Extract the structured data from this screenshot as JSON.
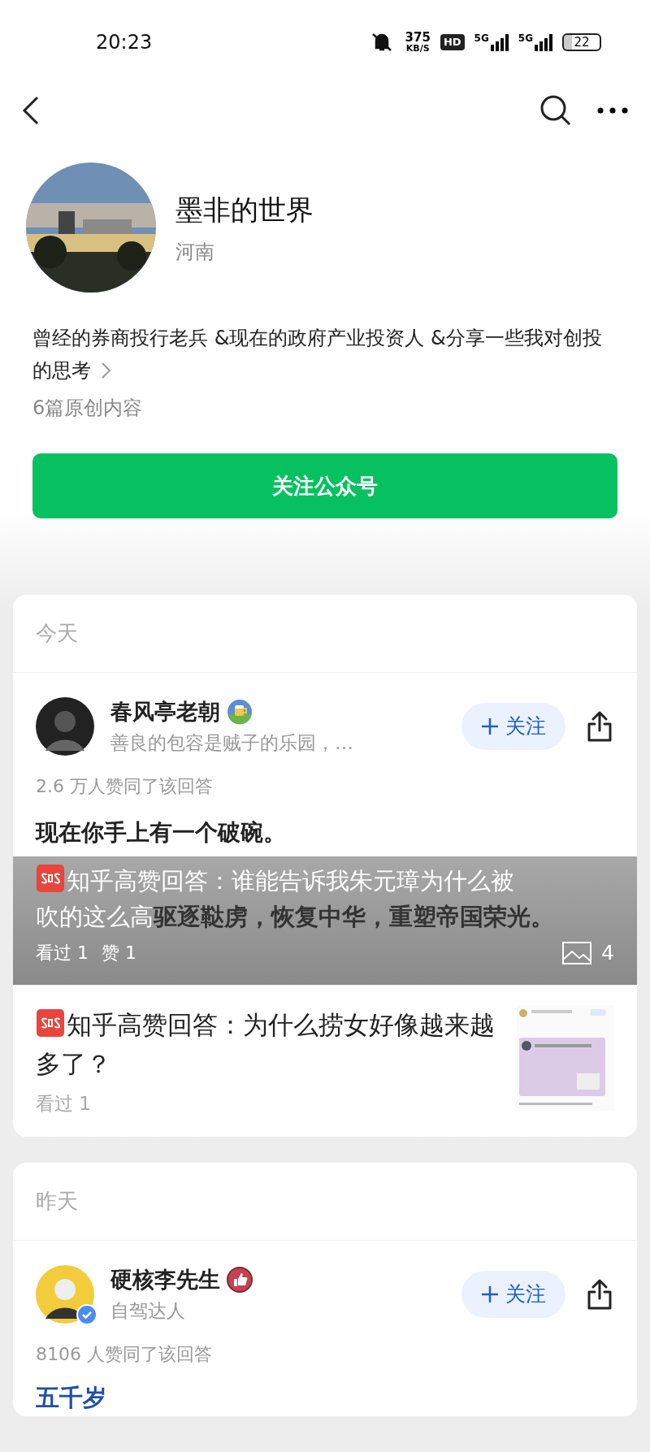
{
  "status_bar": {
    "time": "20:23",
    "speed": "375",
    "speed_unit": "KB/S",
    "hd": "HD",
    "net1": "5G",
    "net2": "5G",
    "battery": "22"
  },
  "profile": {
    "name": "墨非的世界",
    "location": "河南",
    "bio": "曾经的券商投行老兵 &现在的政府产业投资人 &分享一些我对创投的思考",
    "count": "6篇原创内容",
    "follow_button": "关注公众号"
  },
  "sections": [
    {
      "date": "今天",
      "items": [
        {
          "kind": "answer",
          "author": "春风亭老朝",
          "author_desc": "善良的包容是贼子的乐园，…",
          "verified": false,
          "badge": {
            "kind": "mug"
          },
          "follow": "关注",
          "likes": "2.6 万人赞同了该回答",
          "headline": "现在你手上有一个破碗。",
          "overlay_title_1": "知乎高赞回答：谁能告诉我朱元璋为什么被",
          "overlay_title_2": "吹的这么高",
          "body": "驱逐鞑虏，恢复中华，重塑帝国荣光。",
          "views": "看过 1",
          "upvotes": "赞 1",
          "images": "4"
        },
        {
          "kind": "article",
          "title": "知乎高赞回答：为什么捞女好像越来越多了？",
          "views": "看过 1"
        }
      ]
    },
    {
      "date": "昨天",
      "items": [
        {
          "kind": "answer_short",
          "author": "硬核李先生",
          "author_desc": "自驾达人",
          "verified": true,
          "badge": {
            "kind": "thumb"
          },
          "follow": "关注",
          "likes": "8106 人赞同了该回答",
          "headline": "五千岁"
        }
      ]
    }
  ]
}
